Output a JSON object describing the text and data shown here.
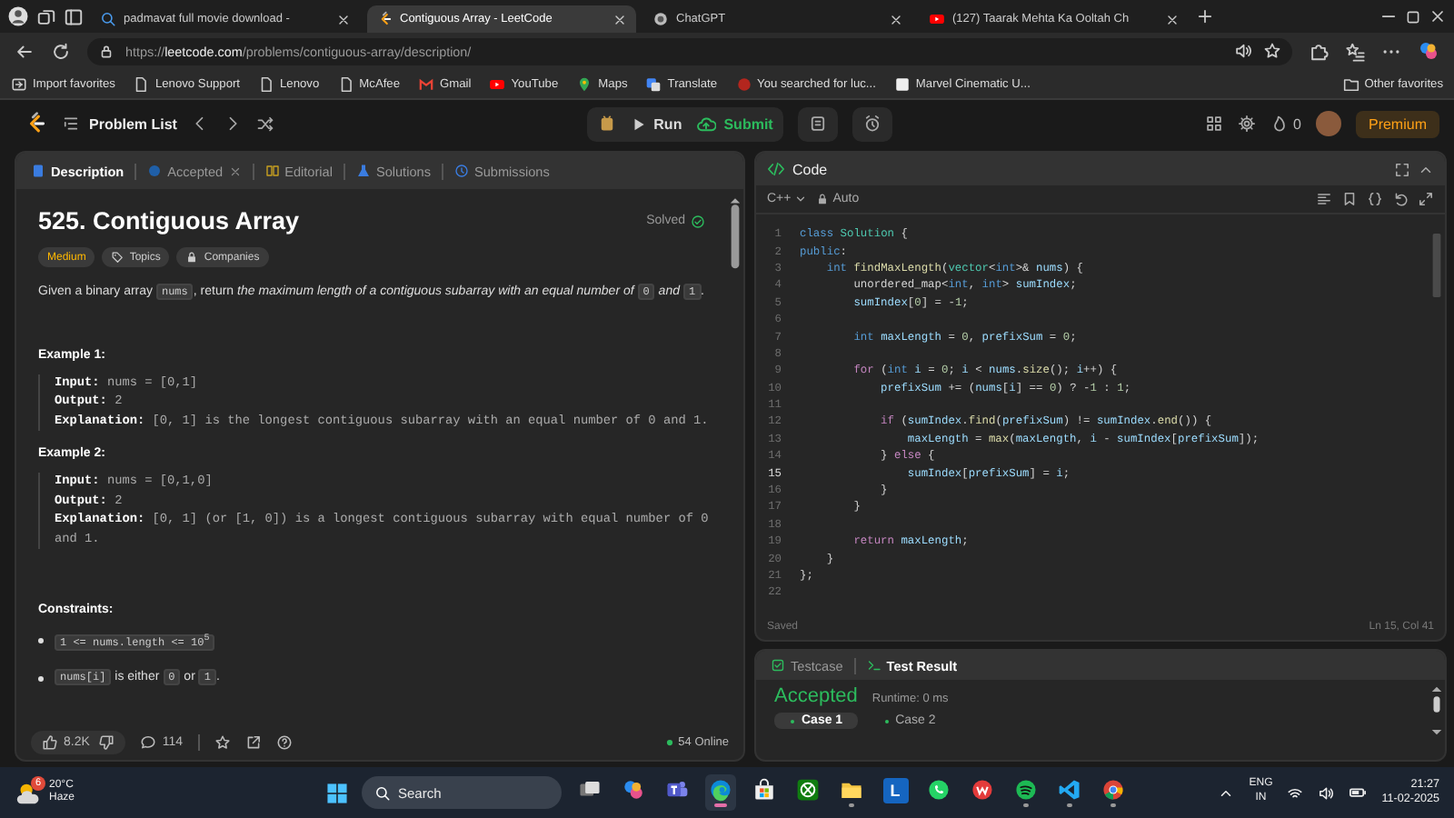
{
  "browser": {
    "tabs": [
      {
        "title": "padmavat full movie download -",
        "kind": "search",
        "selected": false
      },
      {
        "title": "Contiguous Array - LeetCode",
        "kind": "leetcode",
        "selected": true
      },
      {
        "title": "ChatGPT",
        "kind": "chat",
        "selected": false
      },
      {
        "title": "(127) Taarak Mehta Ka Ooltah Ch",
        "kind": "video",
        "selected": false
      }
    ],
    "url": {
      "scheme": "https://",
      "host": "leetcode.com",
      "path": "/problems/contiguous-array/description/"
    },
    "bookmarks": [
      {
        "label": "Import favorites",
        "kind": "import"
      },
      {
        "label": "Lenovo Support",
        "kind": "page"
      },
      {
        "label": "Lenovo",
        "kind": "page"
      },
      {
        "label": "McAfee",
        "kind": "page"
      },
      {
        "label": "Gmail",
        "kind": "mail"
      },
      {
        "label": "YouTube",
        "kind": "video"
      },
      {
        "label": "Maps",
        "kind": "map"
      },
      {
        "label": "Translate",
        "kind": "translate"
      },
      {
        "label": "You searched for luc...",
        "kind": "site"
      },
      {
        "label": "Marvel Cinematic U...",
        "kind": "wiki"
      }
    ],
    "other_bookmarks": "Other favorites"
  },
  "nav": {
    "problem_list": "Problem List",
    "run": "Run",
    "submit": "Submit",
    "streak": "0",
    "premium": "Premium"
  },
  "description": {
    "tabs": [
      {
        "label": "Description",
        "kind": "description",
        "selected": true,
        "closable": false
      },
      {
        "label": "Accepted",
        "kind": "accepted",
        "selected": false,
        "closable": true
      },
      {
        "label": "Editorial",
        "kind": "editorial",
        "selected": false,
        "closable": false
      },
      {
        "label": "Solutions",
        "kind": "solutions",
        "selected": false,
        "closable": false
      },
      {
        "label": "Submissions",
        "kind": "submissions",
        "selected": false,
        "closable": false
      }
    ],
    "title": "525. Contiguous Array",
    "status": "Solved",
    "tags": [
      {
        "label": "Medium",
        "kind": "difficulty"
      },
      {
        "label": "Topics",
        "kind": "topics"
      },
      {
        "label": "Companies",
        "kind": "companies"
      }
    ],
    "statement": [
      {
        "kind": "text",
        "text": "Given a binary array "
      },
      {
        "kind": "code",
        "text": "nums"
      },
      {
        "kind": "text",
        "text": ", return "
      },
      {
        "kind": "italic",
        "text": "the maximum length of a contiguous subarray with an equal number of "
      },
      {
        "kind": "code",
        "text": "0"
      },
      {
        "kind": "italic",
        "text": " and "
      },
      {
        "kind": "code",
        "text": "1"
      },
      {
        "kind": "text",
        "text": "."
      }
    ],
    "examples": [
      {
        "heading": "Example 1:",
        "lines": [
          {
            "label": "Input:",
            "value": "nums = [0,1]"
          },
          {
            "label": "Output:",
            "value": "2"
          },
          {
            "label": "Explanation:",
            "value": "[0, 1] is the longest contiguous subarray with an equal number of 0 and 1."
          }
        ]
      },
      {
        "heading": "Example 2:",
        "lines": [
          {
            "label": "Input:",
            "value": "nums = [0,1,0]"
          },
          {
            "label": "Output:",
            "value": "2"
          },
          {
            "label": "Explanation:",
            "value": "[0, 1] (or [1, 0]) is a longest contiguous subarray with equal number of 0 and 1."
          }
        ]
      }
    ],
    "constraints_heading": "Constraints:",
    "constraints": [
      [
        {
          "kind": "code",
          "text": "1 <= nums.length <= 10$^{5}$"
        }
      ],
      [
        {
          "kind": "code",
          "text": "nums[i]"
        },
        {
          "kind": "text",
          "text": " is either "
        },
        {
          "kind": "code",
          "text": "0"
        },
        {
          "kind": "text",
          "text": " or "
        },
        {
          "kind": "code",
          "text": "1"
        },
        {
          "kind": "text",
          "text": "."
        }
      ]
    ],
    "likes": "8.2K",
    "comments": "114",
    "online": "54 Online"
  },
  "editor": {
    "title": "Code",
    "language": "C++",
    "mode": "Auto",
    "lines": [
      {
        "number": "1",
        "current": false,
        "tokens": [
          {
            "kind": "keyword",
            "text": "class"
          },
          {
            "kind": "type",
            "text": " Solution"
          },
          {
            "kind": "plain",
            "text": " {"
          }
        ]
      },
      {
        "number": "2",
        "current": false,
        "tokens": [
          {
            "kind": "keyword",
            "text": "public"
          },
          {
            "kind": "plain",
            "text": ":"
          }
        ]
      },
      {
        "number": "3",
        "current": false,
        "tokens": [
          {
            "kind": "keyword",
            "text": "    int"
          },
          {
            "kind": "function",
            "text": " findMaxLength"
          },
          {
            "kind": "plain",
            "text": "("
          },
          {
            "kind": "type",
            "text": "vector"
          },
          {
            "kind": "plain",
            "text": "<"
          },
          {
            "kind": "keyword",
            "text": "int"
          },
          {
            "kind": "plain",
            "text": ">& "
          },
          {
            "kind": "name",
            "text": "nums"
          },
          {
            "kind": "plain",
            "text": ") {"
          }
        ]
      },
      {
        "number": "4",
        "current": false,
        "tokens": [
          {
            "kind": "plain",
            "text": "        unordered_map<"
          },
          {
            "kind": "keyword",
            "text": "int"
          },
          {
            "kind": "plain",
            "text": ", "
          },
          {
            "kind": "keyword",
            "text": "int"
          },
          {
            "kind": "plain",
            "text": "> "
          },
          {
            "kind": "name",
            "text": "sumIndex"
          },
          {
            "kind": "plain",
            "text": ";"
          }
        ]
      },
      {
        "number": "5",
        "current": false,
        "tokens": [
          {
            "kind": "name",
            "text": "        sumIndex"
          },
          {
            "kind": "plain",
            "text": "["
          },
          {
            "kind": "number",
            "text": "0"
          },
          {
            "kind": "plain",
            "text": "] = -"
          },
          {
            "kind": "number",
            "text": "1"
          },
          {
            "kind": "plain",
            "text": ";"
          }
        ]
      },
      {
        "number": "6",
        "current": false
      },
      {
        "number": "7",
        "current": false,
        "tokens": [
          {
            "kind": "keyword",
            "text": "        int"
          },
          {
            "kind": "name",
            "text": " maxLength"
          },
          {
            "kind": "plain",
            "text": " = "
          },
          {
            "kind": "number",
            "text": "0"
          },
          {
            "kind": "plain",
            "text": ", "
          },
          {
            "kind": "name",
            "text": "prefixSum"
          },
          {
            "kind": "plain",
            "text": " = "
          },
          {
            "kind": "number",
            "text": "0"
          },
          {
            "kind": "plain",
            "text": ";"
          }
        ]
      },
      {
        "number": "8",
        "current": false
      },
      {
        "number": "9",
        "current": false,
        "tokens": [
          {
            "kind": "control",
            "text": "        for"
          },
          {
            "kind": "plain",
            "text": " ("
          },
          {
            "kind": "keyword",
            "text": "int"
          },
          {
            "kind": "name",
            "text": " i"
          },
          {
            "kind": "plain",
            "text": " = "
          },
          {
            "kind": "number",
            "text": "0"
          },
          {
            "kind": "plain",
            "text": "; "
          },
          {
            "kind": "name",
            "text": "i"
          },
          {
            "kind": "plain",
            "text": " < "
          },
          {
            "kind": "name",
            "text": "nums"
          },
          {
            "kind": "plain",
            "text": "."
          },
          {
            "kind": "function",
            "text": "size"
          },
          {
            "kind": "plain",
            "text": "(); "
          },
          {
            "kind": "name",
            "text": "i"
          },
          {
            "kind": "plain",
            "text": "++) {"
          }
        ]
      },
      {
        "number": "10",
        "current": false,
        "tokens": [
          {
            "kind": "name",
            "text": "            prefixSum"
          },
          {
            "kind": "plain",
            "text": " += ("
          },
          {
            "kind": "name",
            "text": "nums"
          },
          {
            "kind": "plain",
            "text": "["
          },
          {
            "kind": "name",
            "text": "i"
          },
          {
            "kind": "plain",
            "text": "] == "
          },
          {
            "kind": "number",
            "text": "0"
          },
          {
            "kind": "plain",
            "text": ") ? -"
          },
          {
            "kind": "number",
            "text": "1"
          },
          {
            "kind": "plain",
            "text": " : "
          },
          {
            "kind": "number",
            "text": "1"
          },
          {
            "kind": "plain",
            "text": ";"
          }
        ]
      },
      {
        "number": "11",
        "current": false
      },
      {
        "number": "12",
        "current": false,
        "tokens": [
          {
            "kind": "control",
            "text": "            if"
          },
          {
            "kind": "plain",
            "text": " ("
          },
          {
            "kind": "name",
            "text": "sumIndex"
          },
          {
            "kind": "plain",
            "text": "."
          },
          {
            "kind": "function",
            "text": "find"
          },
          {
            "kind": "plain",
            "text": "("
          },
          {
            "kind": "name",
            "text": "prefixSum"
          },
          {
            "kind": "plain",
            "text": ") != "
          },
          {
            "kind": "name",
            "text": "sumIndex"
          },
          {
            "kind": "plain",
            "text": "."
          },
          {
            "kind": "function",
            "text": "end"
          },
          {
            "kind": "plain",
            "text": "()) {"
          }
        ]
      },
      {
        "number": "13",
        "current": false,
        "tokens": [
          {
            "kind": "name",
            "text": "                maxLength"
          },
          {
            "kind": "plain",
            "text": " = "
          },
          {
            "kind": "function",
            "text": "max"
          },
          {
            "kind": "plain",
            "text": "("
          },
          {
            "kind": "name",
            "text": "maxLength"
          },
          {
            "kind": "plain",
            "text": ", "
          },
          {
            "kind": "name",
            "text": "i"
          },
          {
            "kind": "plain",
            "text": " - "
          },
          {
            "kind": "name",
            "text": "sumIndex"
          },
          {
            "kind": "plain",
            "text": "["
          },
          {
            "kind": "name",
            "text": "prefixSum"
          },
          {
            "kind": "plain",
            "text": "]);"
          }
        ]
      },
      {
        "number": "14",
        "current": false,
        "tokens": [
          {
            "kind": "plain",
            "text": "            } "
          },
          {
            "kind": "control",
            "text": "else"
          },
          {
            "kind": "plain",
            "text": " {"
          }
        ]
      },
      {
        "number": "15",
        "current": true,
        "tokens": [
          {
            "kind": "name",
            "text": "                sumIndex"
          },
          {
            "kind": "plain",
            "text": "["
          },
          {
            "kind": "name",
            "text": "prefixSum"
          },
          {
            "kind": "plain",
            "text": "] = "
          },
          {
            "kind": "name",
            "text": "i"
          },
          {
            "kind": "plain",
            "text": ";"
          }
        ]
      },
      {
        "number": "16",
        "current": false,
        "tokens": [
          {
            "kind": "plain",
            "text": "            }"
          }
        ]
      },
      {
        "number": "17",
        "current": false,
        "tokens": [
          {
            "kind": "plain",
            "text": "        }"
          }
        ]
      },
      {
        "number": "18",
        "current": false
      },
      {
        "number": "19",
        "current": false,
        "tokens": [
          {
            "kind": "control",
            "text": "        return"
          },
          {
            "kind": "name",
            "text": " maxLength"
          },
          {
            "kind": "plain",
            "text": ";"
          }
        ]
      },
      {
        "number": "20",
        "current": false,
        "tokens": [
          {
            "kind": "plain",
            "text": "    }"
          }
        ]
      },
      {
        "number": "21",
        "current": false,
        "tokens": [
          {
            "kind": "plain",
            "text": "};"
          }
        ]
      },
      {
        "number": "22",
        "current": false
      }
    ],
    "status": "Saved",
    "cursor": "Ln 15, Col 41"
  },
  "results": {
    "tabs": [
      {
        "label": "Testcase",
        "kind": "testcase",
        "selected": false
      },
      {
        "label": "Test Result",
        "kind": "result",
        "selected": true
      }
    ],
    "verdict": "Accepted",
    "runtime": "Runtime: 0 ms",
    "cases": [
      {
        "label": "Case 1",
        "selected": true
      },
      {
        "label": "Case 2",
        "selected": false
      }
    ]
  },
  "taskbar": {
    "weather": {
      "temperature": "20°C",
      "condition": "Haze",
      "badge": "6"
    },
    "search_placeholder": "Search",
    "apps": [
      {
        "kind": "taskview",
        "open": false,
        "selected": false
      },
      {
        "kind": "copilot",
        "open": false,
        "selected": false
      },
      {
        "kind": "teams",
        "open": false,
        "selected": false
      },
      {
        "kind": "edge",
        "open": true,
        "selected": true
      },
      {
        "kind": "store",
        "open": false,
        "selected": false
      },
      {
        "kind": "xbox",
        "open": false,
        "selected": false
      },
      {
        "kind": "explorer",
        "open": true,
        "selected": false
      },
      {
        "kind": "tile",
        "label": "L",
        "open": false,
        "selected": false
      },
      {
        "kind": "whatsapp",
        "open": false,
        "selected": false
      },
      {
        "kind": "wps",
        "open": false,
        "selected": false
      },
      {
        "kind": "spotify",
        "open": true,
        "selected": false
      },
      {
        "kind": "vscode",
        "open": true,
        "selected": false
      },
      {
        "kind": "chrome",
        "open": true,
        "selected": false
      }
    ],
    "language": "ENG",
    "region": "IN",
    "time": "21:27",
    "date": "11-02-2025"
  }
}
